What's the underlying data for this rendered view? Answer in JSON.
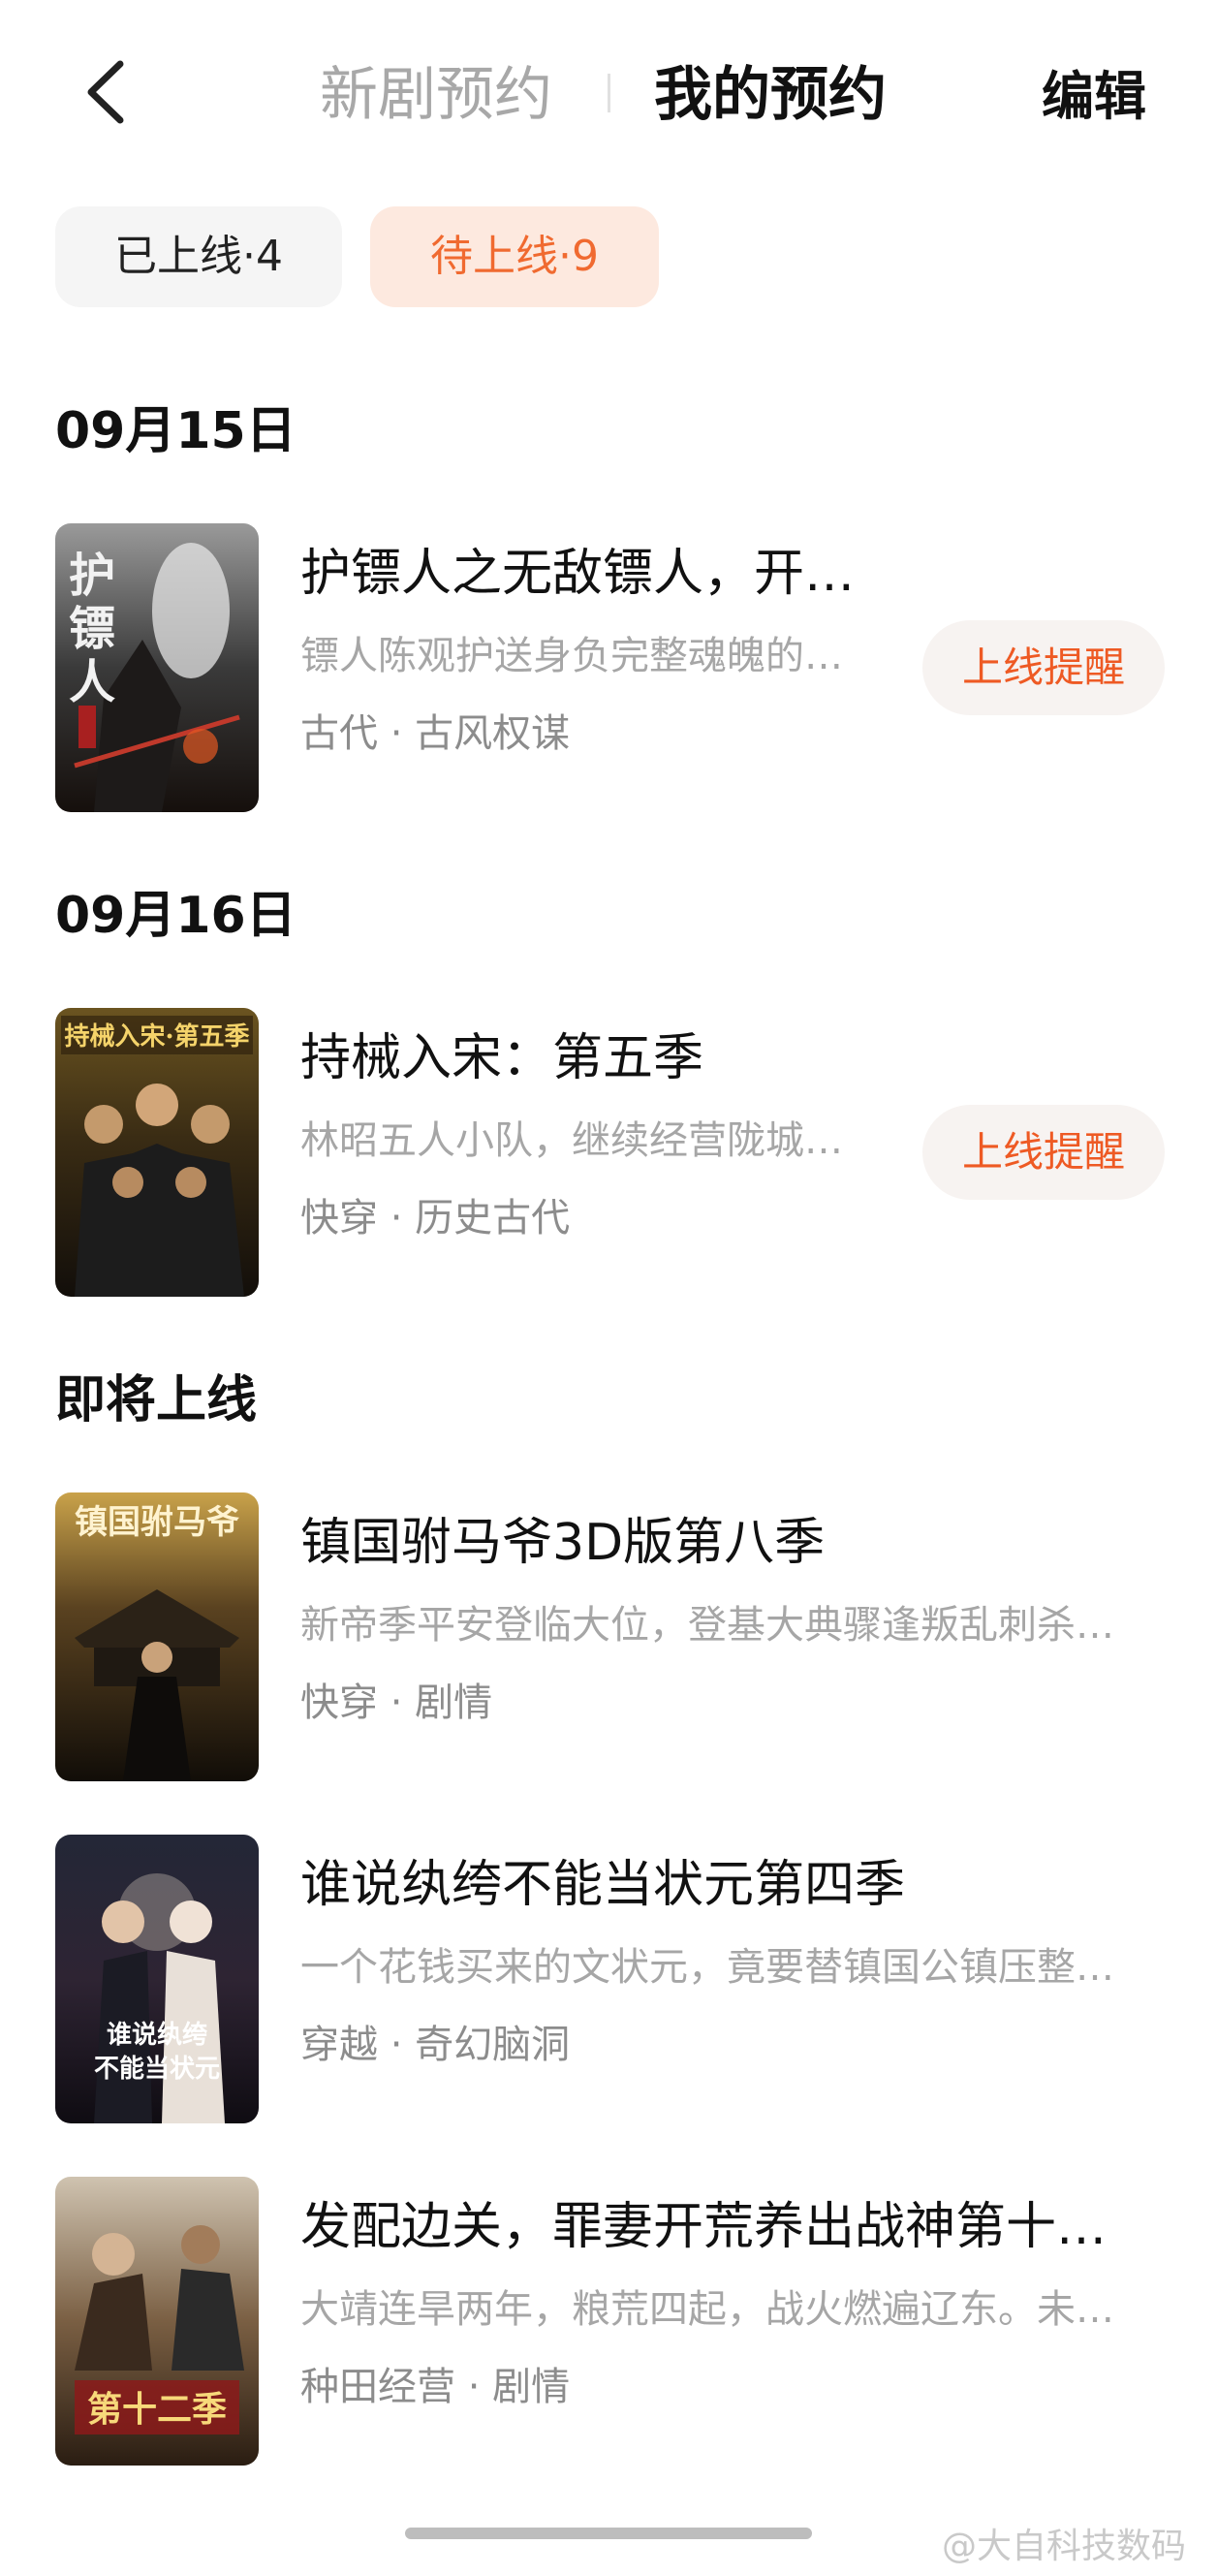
{
  "header": {
    "tab_new": "新剧预约",
    "tab_mine": "我的预约",
    "edit_label": "编辑"
  },
  "filters": {
    "online": "已上线·4",
    "upcoming": "待上线·9"
  },
  "sections": [
    {
      "title": "09月15日",
      "items": [
        {
          "title": "护镖人之无敌镖人，开…",
          "desc": "镖人陈观护送身负完整魂魄的…",
          "tags": "古代 · 古风权谋",
          "button": "上线提醒",
          "poster_text": "护镖人"
        }
      ]
    },
    {
      "title": "09月16日",
      "items": [
        {
          "title": "持械入宋：第五季",
          "desc": "林昭五人小队，继续经营陇城…",
          "tags": "快穿 · 历史古代",
          "button": "上线提醒",
          "poster_text": "持械入宋·第五季"
        }
      ]
    },
    {
      "title": "即将上线",
      "items": [
        {
          "title": "镇国驸马爷3D版第八季",
          "desc": "新帝季平安登临大位，登基大典骤逢叛乱刺杀…",
          "tags": "快穿 · 剧情",
          "poster_text": "镇国驸马爷"
        },
        {
          "title": "谁说纨绔不能当状元第四季",
          "desc": "一个花钱买来的文状元，竟要替镇国公镇压整…",
          "tags": "穿越 · 奇幻脑洞",
          "poster_text": "谁说纨绔不能当状元"
        },
        {
          "title": "发配边关，罪妻开荒养出战神第十…",
          "desc": "大靖连旱两年，粮荒四起，战火燃遍辽东。未…",
          "tags": "种田经营 · 剧情",
          "poster_text": "第十二季"
        }
      ]
    }
  ],
  "watermark": "@大自科技数码",
  "colors": {
    "accent": "#ee5a24",
    "accent_chip_bg": "#fde9df",
    "remind_bg": "#f7f3f1",
    "muted_text": "#a6a6a6"
  }
}
